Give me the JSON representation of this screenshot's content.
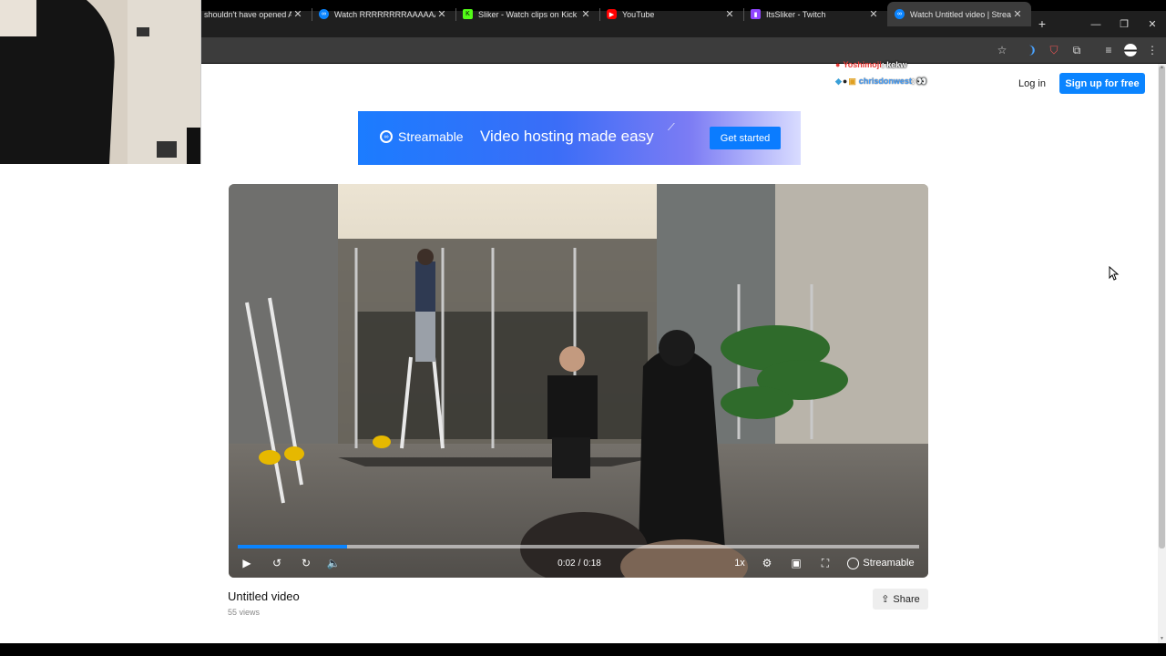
{
  "browser": {
    "tabs": [
      {
        "title": "shouldn't have opened AZ",
        "favicon": "none",
        "active": false
      },
      {
        "title": "Watch RRRRRRRRAAAAAAAAT",
        "favicon": "streamable",
        "active": false
      },
      {
        "title": "Sliker - Watch clips on Kick",
        "favicon": "kick",
        "active": false
      },
      {
        "title": "YouTube",
        "favicon": "youtube",
        "active": false
      },
      {
        "title": "ItsSliker - Twitch",
        "favicon": "twitch",
        "active": false
      },
      {
        "title": "Watch Untitled video | Streamable",
        "favicon": "streamable",
        "active": true
      }
    ],
    "close_glyph": "✕",
    "new_tab_glyph": "+",
    "colors": {
      "tabstrip": "#1f1f1f",
      "active_tab": "#3c3c3c"
    }
  },
  "header": {
    "login": "Log in",
    "signup": "Sign up for free"
  },
  "banner": {
    "brand": "Streamable",
    "tagline": "Video hosting made easy",
    "cta": "Get started"
  },
  "player": {
    "current_time": "0:02",
    "duration": "0:18",
    "progress_fraction": 0.16,
    "speed": "1x",
    "brand": "Streamable",
    "accent": "#0a84ff"
  },
  "video": {
    "title": "Untitled video",
    "views": "55 views",
    "share": "Share"
  },
  "chat": [
    {
      "user": "Yoshimoji",
      "message": "kekw"
    },
    {
      "user": "chrisdonwest",
      "message": "👀"
    }
  ]
}
